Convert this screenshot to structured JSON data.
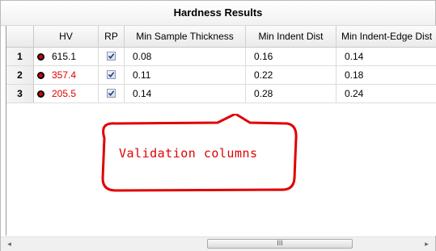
{
  "panel": {
    "title": "Hardness Results"
  },
  "columns": [
    "HV",
    "RP",
    "Min Sample Thickness",
    "Min Indent Dist",
    "Min Indent-Edge Dist"
  ],
  "rows": [
    {
      "num": "1",
      "hv": "615.1",
      "hv_red": false,
      "rp_checked": true,
      "thickness": "0.08",
      "indent_dist": "0.16",
      "edge_dist": "0.14"
    },
    {
      "num": "2",
      "hv": "357.4",
      "hv_red": true,
      "rp_checked": true,
      "thickness": "0.11",
      "indent_dist": "0.22",
      "edge_dist": "0.18"
    },
    {
      "num": "3",
      "hv": "205.5",
      "hv_red": true,
      "rp_checked": true,
      "thickness": "0.14",
      "indent_dist": "0.28",
      "edge_dist": "0.24"
    }
  ],
  "annotation": {
    "text": "Validation columns",
    "color": "#e00000"
  },
  "scrollbar": {
    "left_arrow": "◂",
    "right_arrow": "▸",
    "thumb_grip": "III"
  },
  "colors": {
    "red_value": "#e00000",
    "marker_fill": "#e00000"
  }
}
